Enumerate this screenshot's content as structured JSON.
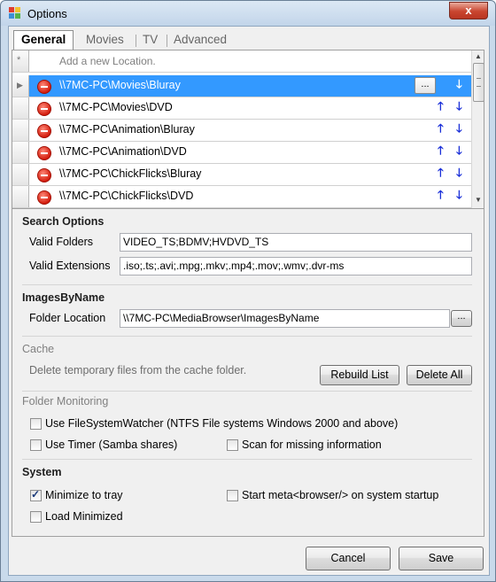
{
  "window": {
    "title": "Options",
    "close_glyph": "x"
  },
  "tabs": [
    {
      "label": "General",
      "active": true
    },
    {
      "label": "Movies",
      "active": false
    },
    {
      "label": "TV",
      "active": false
    },
    {
      "label": "Advanced",
      "active": false
    }
  ],
  "locations": {
    "new_row_marker": "*",
    "add_placeholder": "Add a new Location.",
    "browse_label": "...",
    "up_arrow": "🡑",
    "down_arrow": "🡓",
    "rows": [
      {
        "path": "\\\\7MC-PC\\Movies\\Bluray",
        "selected": true
      },
      {
        "path": "\\\\7MC-PC\\Movies\\DVD",
        "selected": false
      },
      {
        "path": "\\\\7MC-PC\\Animation\\Bluray",
        "selected": false
      },
      {
        "path": "\\\\7MC-PC\\Animation\\DVD",
        "selected": false
      },
      {
        "path": "\\\\7MC-PC\\ChickFlicks\\Bluray",
        "selected": false
      },
      {
        "path": "\\\\7MC-PC\\ChickFlicks\\DVD",
        "selected": false
      }
    ]
  },
  "search_options": {
    "heading": "Search Options",
    "valid_folders_label": "Valid Folders",
    "valid_folders_value": "VIDEO_TS;BDMV;HVDVD_TS",
    "valid_extensions_label": "Valid Extensions",
    "valid_extensions_value": ".iso;.ts;.avi;.mpg;.mkv;.mp4;.mov;.wmv;.dvr-ms"
  },
  "images_by_name": {
    "heading": "ImagesByName",
    "folder_location_label": "Folder Location",
    "folder_location_value": "\\\\7MC-PC\\MediaBrowser\\ImagesByName",
    "browse_label": "..."
  },
  "cache": {
    "heading": "Cache",
    "description": "Delete temporary files from the cache folder.",
    "rebuild_label": "Rebuild List",
    "delete_all_label": "Delete All"
  },
  "folder_monitoring": {
    "heading": "Folder Monitoring",
    "use_filesystemwatcher": {
      "label": "Use FileSystemWatcher (NTFS File systems Windows 2000 and above)",
      "checked": false
    },
    "use_timer": {
      "label": "Use Timer (Samba shares)",
      "checked": false
    },
    "scan_missing": {
      "label": "Scan for missing information",
      "checked": false
    }
  },
  "system": {
    "heading": "System",
    "minimize_to_tray": {
      "label": "Minimize to tray",
      "checked": true
    },
    "start_on_startup": {
      "label": "Start meta<browser/> on system startup",
      "checked": false
    },
    "load_minimized": {
      "label": "Load Minimized",
      "checked": false
    }
  },
  "footer": {
    "cancel_label": "Cancel",
    "save_label": "Save"
  },
  "colors": {
    "selection": "#3399ff",
    "arrow": "#1a2fd8",
    "remove": "#d41e0e",
    "close_button": "#c9452f"
  }
}
